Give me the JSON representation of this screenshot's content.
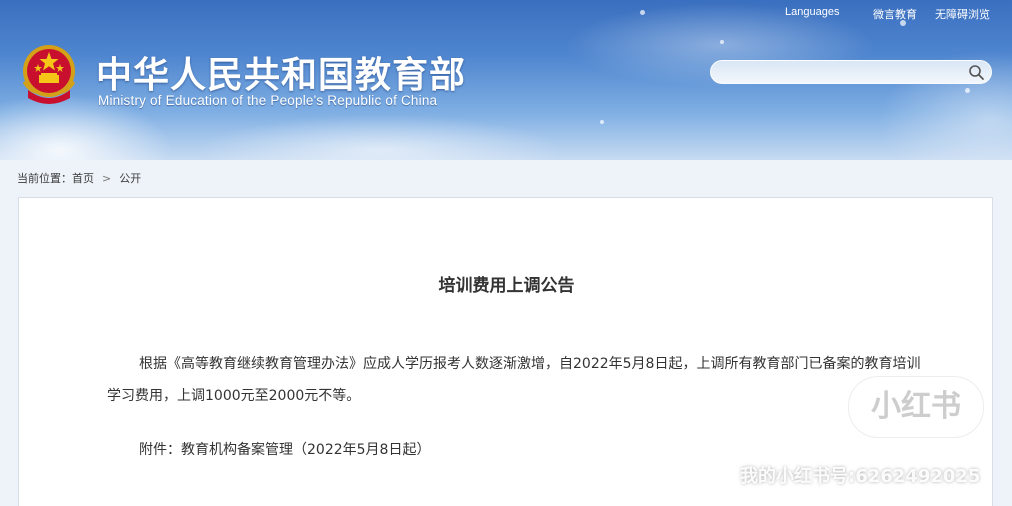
{
  "header": {
    "title_cn": "中华人民共和国教育部",
    "title_en": "Ministry of Education of the People's Republic of China",
    "top_links": {
      "languages": "Languages",
      "weixin": "微言教育",
      "accessibility": "无障碍浏览"
    },
    "search": {
      "placeholder": "",
      "value": "",
      "icon": "search-icon"
    },
    "emblem": "national-emblem-icon"
  },
  "breadcrumb": {
    "prefix": "当前位置：",
    "home": "首页",
    "separator": ">",
    "current": "公开"
  },
  "article": {
    "title": "培训费用上调公告",
    "paragraph": "根据《高等教育继续教育管理办法》应成人学历报考人数逐渐激增，自2022年5月8日起，上调所有教育部门已备案的教育培训学习费用，上调1000元至2000元不等。",
    "attachment": "附件：教育机构备案管理（2022年5月8日起）"
  },
  "watermark": {
    "logo": "小红书",
    "id_text": "我的小红书号:6262492025"
  },
  "colors": {
    "banner_top": "#3a6fbf",
    "banner_bottom": "#c7dbf2",
    "text": "#333333",
    "card_bg": "#ffffff"
  }
}
